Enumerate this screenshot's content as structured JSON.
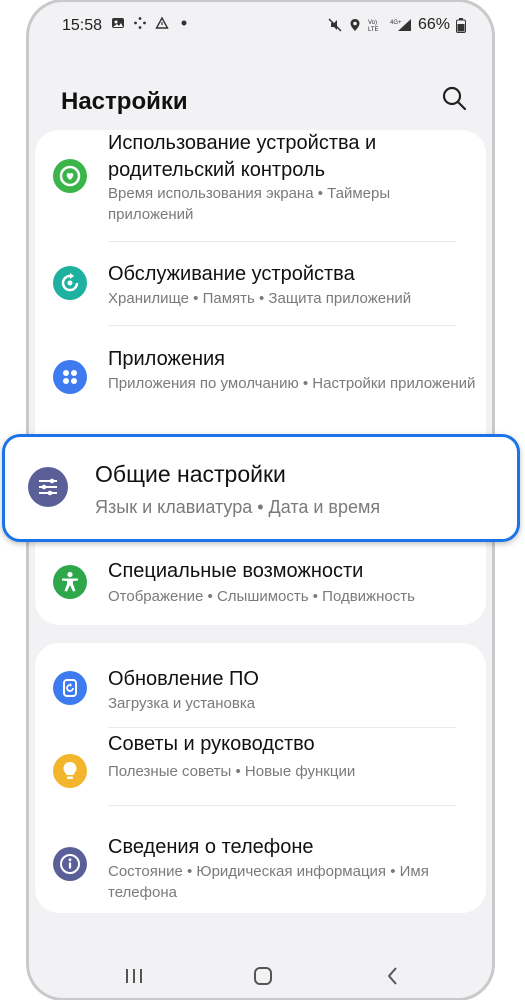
{
  "status_bar": {
    "time": "15:58",
    "battery": "66%",
    "icons_left": [
      "gallery-icon",
      "dots-icon",
      "warning-icon",
      "dot-icon"
    ],
    "icons_right": [
      "mute-icon",
      "location-icon",
      "volte-icon",
      "4g-signal-icon",
      "battery-icon"
    ]
  },
  "header": {
    "title": "Настройки",
    "search_icon": "search-icon"
  },
  "groups": [
    {
      "items": [
        {
          "id": "digital-wellbeing",
          "title_line1": "Использование устройства и",
          "title_line2": "родительский контроль",
          "subtitle": "Время использования экрана • Таймеры приложений",
          "icon": "wellbeing-icon",
          "color": "#3bb54a"
        },
        {
          "id": "device-care",
          "title": "Обслуживание устройства",
          "subtitle": "Хранилище • Память • Защита приложений",
          "icon": "device-care-icon",
          "color": "#1fb1a0"
        },
        {
          "id": "apps",
          "title": "Приложения",
          "subtitle": "Приложения по умолчанию • Настройки приложений",
          "icon": "apps-icon",
          "color": "#3e7bf0"
        },
        {
          "id": "general",
          "title": "Общие настройки",
          "subtitle": "Язык и клавиатура • Дата и время",
          "icon": "sliders-icon",
          "color": "#5b5f98"
        },
        {
          "id": "accessibility",
          "title": "Специальные возможности",
          "subtitle": "Отображение • Слышимость • Подвижность",
          "icon": "accessibility-icon",
          "color": "#2ea64a"
        }
      ]
    },
    {
      "items": [
        {
          "id": "software-update",
          "title": "Обновление ПО",
          "subtitle": "Загрузка и установка",
          "icon": "update-icon",
          "color": "#3e7bf0"
        },
        {
          "id": "tips",
          "title": "Советы и руководство",
          "subtitle": "Полезные советы • Новые функции",
          "icon": "lightbulb-icon",
          "color": "#f2b52b"
        },
        {
          "id": "about",
          "title": "Сведения о телефоне",
          "subtitle": "Состояние • Юридическая информация • Имя телефона",
          "icon": "info-icon",
          "color": "#5b5f98"
        }
      ]
    }
  ],
  "navbar": [
    "recent-apps-icon",
    "home-icon",
    "back-icon"
  ],
  "highlight_color": "#1a73e8"
}
